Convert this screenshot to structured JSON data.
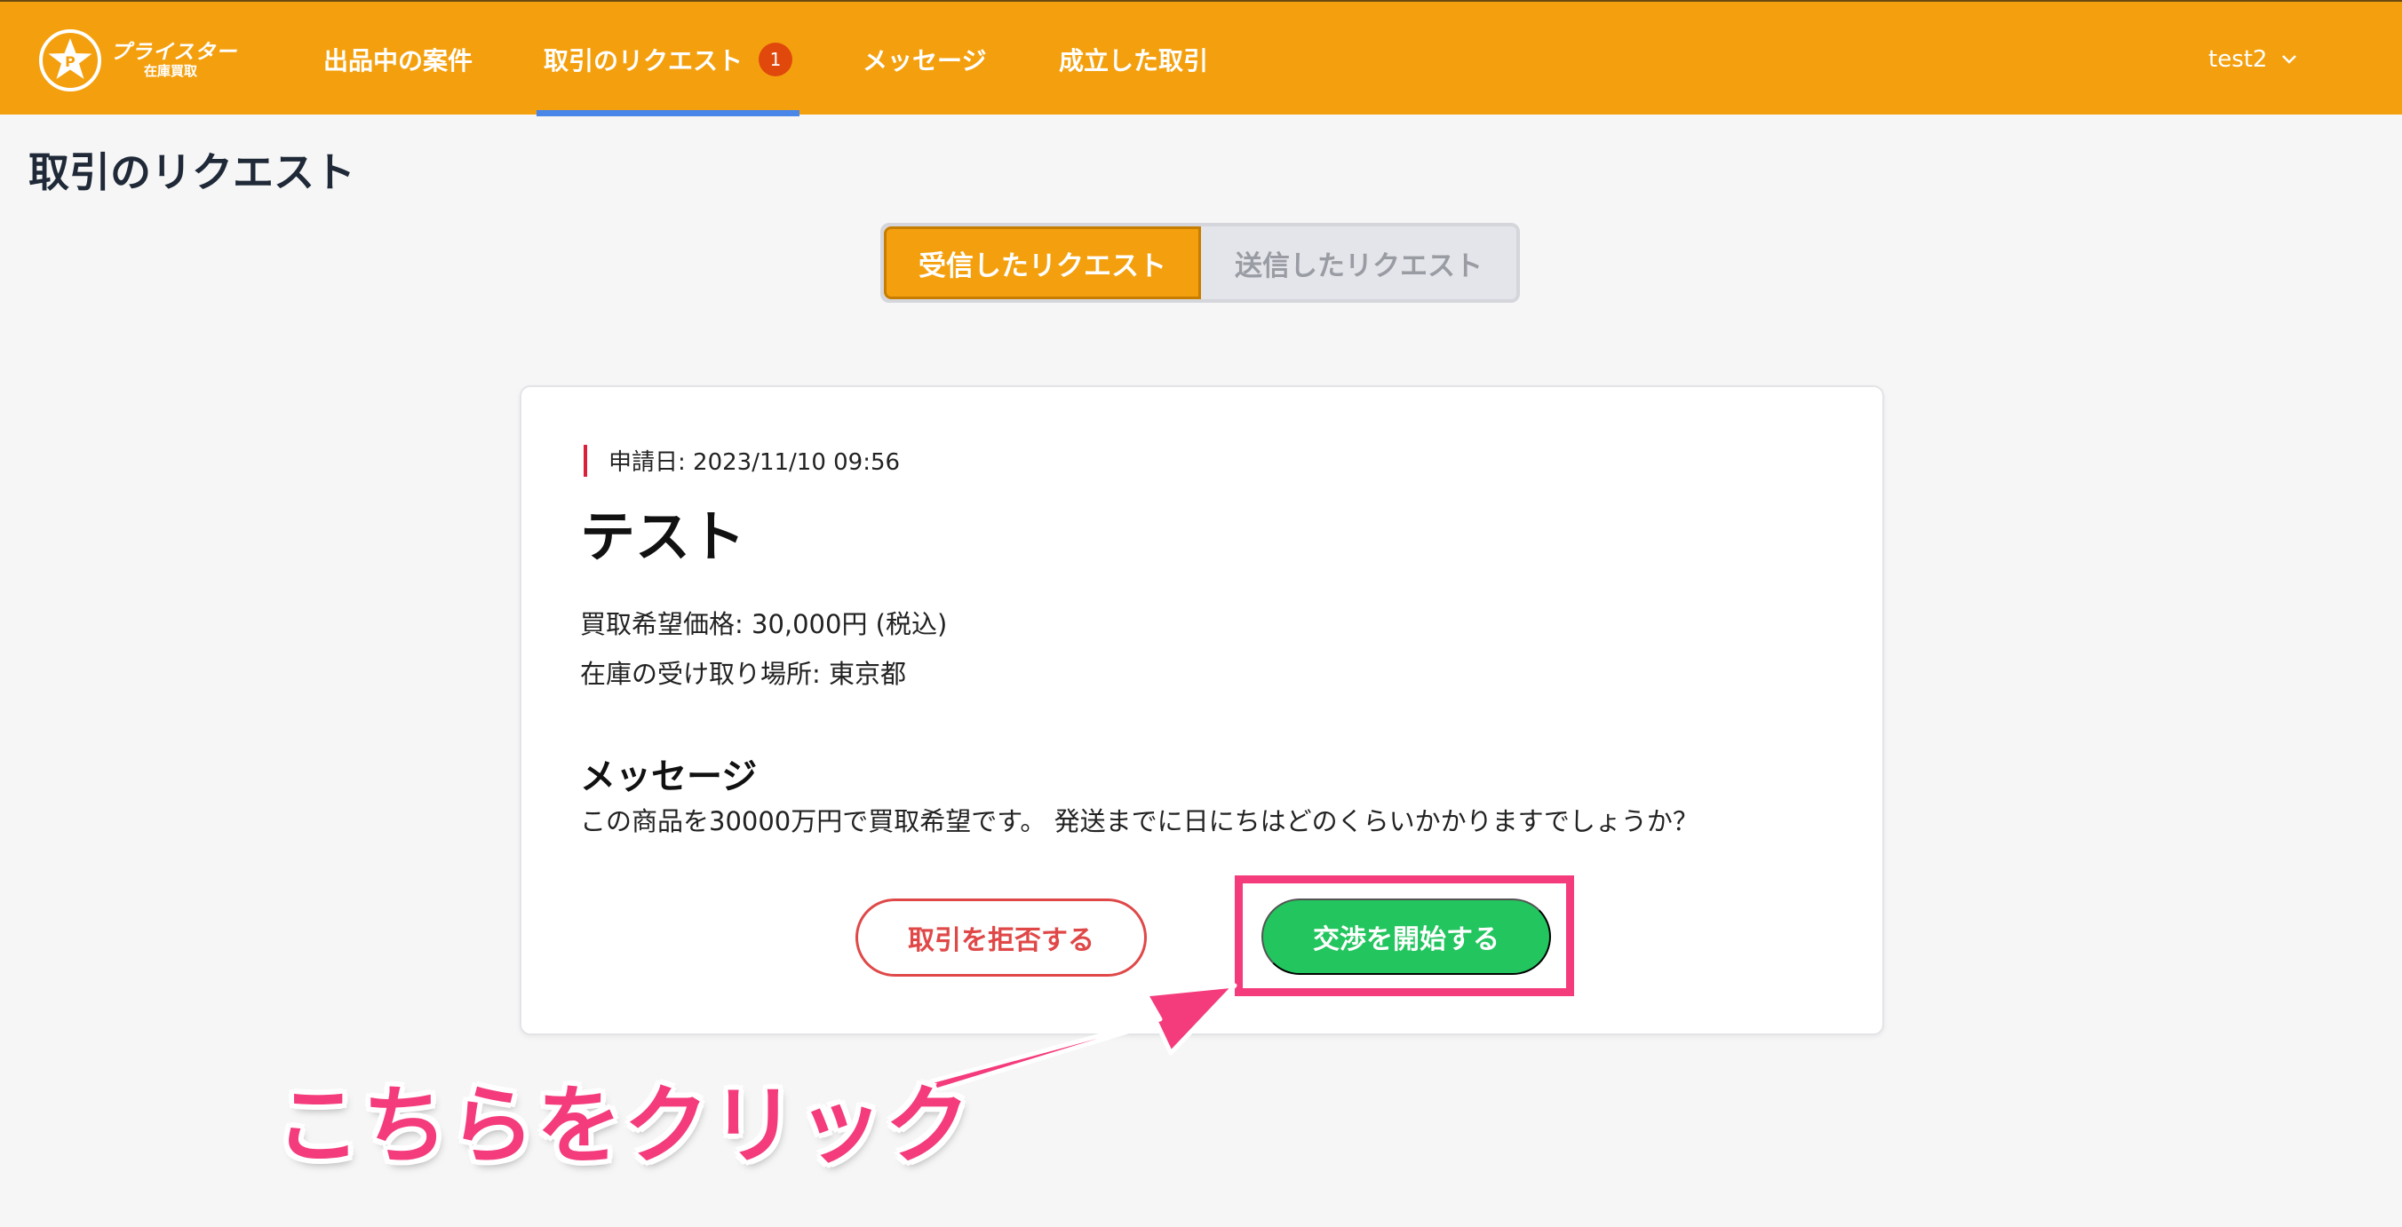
{
  "header": {
    "logo": {
      "brand": "プライスター",
      "sub": "在庫買取",
      "mark": "P"
    },
    "nav": [
      {
        "label": "出品中の案件"
      },
      {
        "label": "取引のリクエスト",
        "badge": "1"
      },
      {
        "label": "メッセージ"
      },
      {
        "label": "成立した取引"
      }
    ],
    "user": {
      "name": "test2",
      "icon": "chevron-down-icon"
    }
  },
  "page_title": "取引のリクエスト",
  "segment": {
    "received": "受信したリクエスト",
    "sent": "送信したリクエスト"
  },
  "card": {
    "date": "申請日: 2023/11/10 09:56",
    "title": "テスト",
    "price": "買取希望価格: 30,000円 (税込)",
    "place": "在庫の受け取り場所: 東京都",
    "message_heading": "メッセージ",
    "message_body": "この商品を30000万円で買取希望です。 発送までに日にちはどのくらいかかりますでしょうか？",
    "reject_label": "取引を拒否する",
    "start_label": "交渉を開始する"
  },
  "annotation": {
    "callout": "こちらをクリック"
  },
  "colors": {
    "header": "#f4a00e",
    "active_tab_underline": "#4a86e8",
    "badge": "#e0480c",
    "reject": "#e04848",
    "start": "#22c55e",
    "annotation": "#f43b7c"
  }
}
